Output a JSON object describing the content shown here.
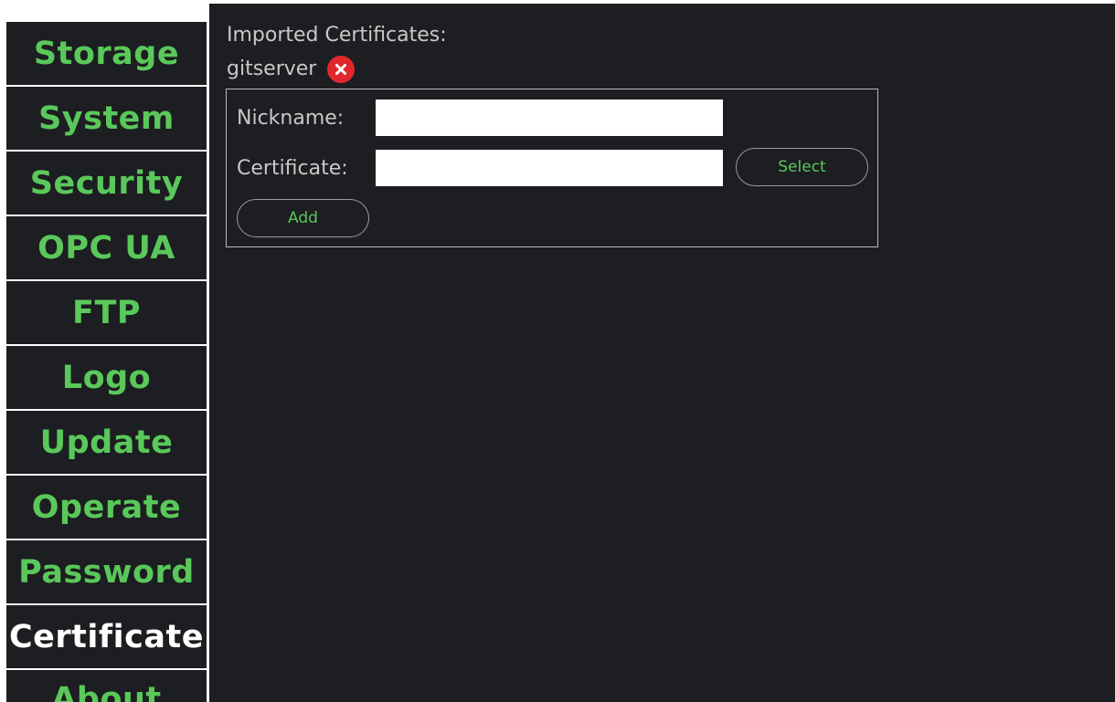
{
  "sidebar": {
    "items": [
      {
        "label": "Storage",
        "active": false
      },
      {
        "label": "System",
        "active": false
      },
      {
        "label": "Security",
        "active": false
      },
      {
        "label": "OPC UA",
        "active": false
      },
      {
        "label": "FTP",
        "active": false
      },
      {
        "label": "Logo",
        "active": false
      },
      {
        "label": "Update",
        "active": false
      },
      {
        "label": "Operate",
        "active": false
      },
      {
        "label": "Password",
        "active": false
      },
      {
        "label": "Certificate",
        "active": true
      },
      {
        "label": "About",
        "active": false
      }
    ]
  },
  "main": {
    "imported_title": "Imported Certificates:",
    "certificates": [
      {
        "name": "gitserver",
        "remove_icon": "close-circle-icon"
      }
    ],
    "form": {
      "nickname_label": "Nickname:",
      "nickname_value": "",
      "certificate_label": "Certificate:",
      "certificate_value": "",
      "select_label": "Select",
      "add_label": "Add"
    }
  },
  "colors": {
    "background": "#1c1e21",
    "accent_green": "#5ac85a",
    "active_text": "#ffffff",
    "danger_red": "#e0282c",
    "label_gray": "#c8c8c8"
  }
}
